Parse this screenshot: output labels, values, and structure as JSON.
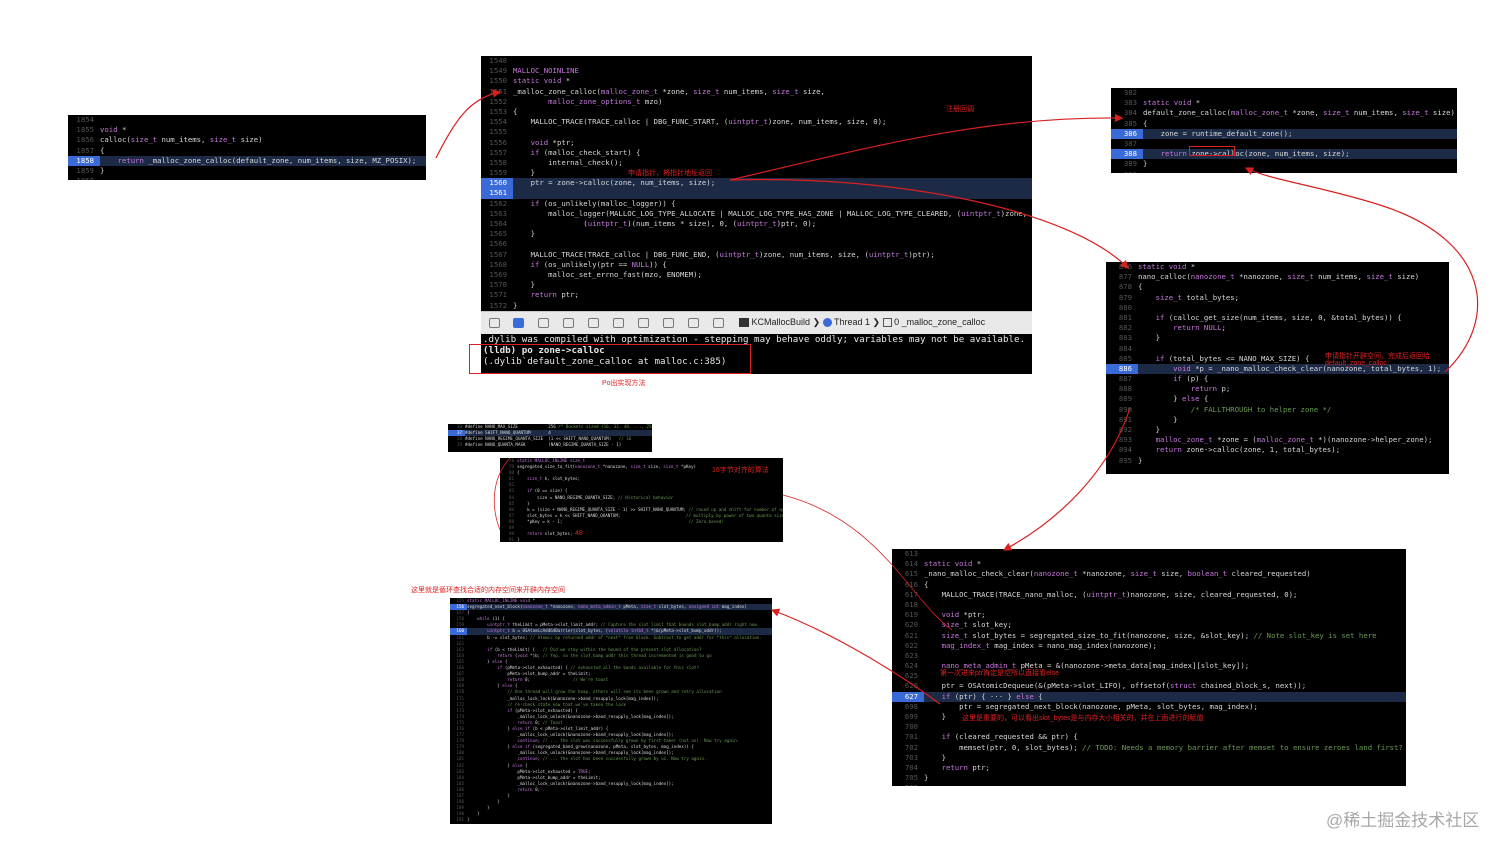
{
  "panels": {
    "calloc": {
      "lines": [
        {
          "n": "1854",
          "t": ""
        },
        {
          "n": "1855",
          "t": "void *"
        },
        {
          "n": "1856",
          "t": "calloc(size_t num_items, size_t size)"
        },
        {
          "n": "1857",
          "t": "{"
        },
        {
          "n": "1858",
          "t": "    return _malloc_zone_calloc(default_zone, num_items, size, MZ_POSIX);",
          "hl": true
        },
        {
          "n": "1859",
          "t": "}"
        },
        {
          "n": "1860",
          "t": ""
        }
      ]
    },
    "malloc_zone_calloc": {
      "lines": [
        {
          "n": "1548",
          "t": ""
        },
        {
          "n": "1549",
          "t": "MALLOC_NOINLINE"
        },
        {
          "n": "1550",
          "t": "static void *"
        },
        {
          "n": "1551",
          "t": "_malloc_zone_calloc(malloc_zone_t *zone, size_t num_items, size_t size,"
        },
        {
          "n": "1552",
          "t": "        malloc_zone_options_t mzo)"
        },
        {
          "n": "1553",
          "t": "{"
        },
        {
          "n": "1554",
          "t": "    MALLOC_TRACE(TRACE_calloc | DBG_FUNC_START, (uintptr_t)zone, num_items, size, 0);"
        },
        {
          "n": "1555",
          "t": ""
        },
        {
          "n": "1556",
          "t": "    void *ptr;"
        },
        {
          "n": "1557",
          "t": "    if (malloc_check_start) {"
        },
        {
          "n": "1558",
          "t": "        internal_check();"
        },
        {
          "n": "1559",
          "t": "    }"
        },
        {
          "n": "1560",
          "t": "    ptr = zone->calloc(zone, num_items, size);",
          "hl": true
        },
        {
          "n": "1561",
          "t": "",
          "hl": true
        },
        {
          "n": "1562",
          "t": "    if (os_unlikely(malloc_logger)) {"
        },
        {
          "n": "1563",
          "t": "        malloc_logger(MALLOC_LOG_TYPE_ALLOCATE | MALLOC_LOG_TYPE_HAS_ZONE | MALLOC_LOG_TYPE_CLEARED, (uintptr_t)zone,"
        },
        {
          "n": "1564",
          "t": "                (uintptr_t)(num_items * size), 0, (uintptr_t)ptr, 0);"
        },
        {
          "n": "1565",
          "t": "    }"
        },
        {
          "n": "1566",
          "t": ""
        },
        {
          "n": "1567",
          "t": "    MALLOC_TRACE(TRACE_calloc | DBG_FUNC_END, (uintptr_t)zone, num_items, size, (uintptr_t)ptr);"
        },
        {
          "n": "1568",
          "t": "    if (os_unlikely(ptr == NULL)) {"
        },
        {
          "n": "1569",
          "t": "        malloc_set_errno_fast(mzo, ENOMEM);"
        },
        {
          "n": "1570",
          "t": "    }"
        },
        {
          "n": "1571",
          "t": "    return ptr;"
        },
        {
          "n": "1572",
          "t": "}"
        }
      ]
    },
    "default_zone_calloc": {
      "lines": [
        {
          "n": "382",
          "t": ""
        },
        {
          "n": "383",
          "t": "static void *"
        },
        {
          "n": "384",
          "t": "default_zone_calloc(malloc_zone_t *zone, size_t num_items, size_t size)"
        },
        {
          "n": "385",
          "t": "{"
        },
        {
          "n": "386",
          "t": "    zone = runtime_default_zone();",
          "hl": true
        },
        {
          "n": "387",
          "t": ""
        },
        {
          "n": "388",
          "t": "    return zone->calloc(zone, num_items, size);",
          "hl": true
        },
        {
          "n": "389",
          "t": "}"
        },
        {
          "n": "390",
          "t": ""
        }
      ]
    },
    "nano_calloc": {
      "lines": [
        {
          "n": "876",
          "t": "static void *"
        },
        {
          "n": "877",
          "t": "nano_calloc(nanozone_t *nanozone, size_t num_items, size_t size)"
        },
        {
          "n": "878",
          "t": "{"
        },
        {
          "n": "879",
          "t": "    size_t total_bytes;"
        },
        {
          "n": "880",
          "t": ""
        },
        {
          "n": "881",
          "t": "    if (calloc_get_size(num_items, size, 0, &total_bytes)) {"
        },
        {
          "n": "882",
          "t": "        return NULL;"
        },
        {
          "n": "883",
          "t": "    }"
        },
        {
          "n": "884",
          "t": ""
        },
        {
          "n": "885",
          "t": "    if (total_bytes <= NANO_MAX_SIZE) {"
        },
        {
          "n": "886",
          "t": "        void *p = _nano_malloc_check_clear(nanozone, total_bytes, 1);",
          "hl": true
        },
        {
          "n": "887",
          "t": "        if (p) {"
        },
        {
          "n": "888",
          "t": "            return p;"
        },
        {
          "n": "889",
          "t": "        } else {"
        },
        {
          "n": "890",
          "t": "            /* FALLTHROUGH to helper zone */"
        },
        {
          "n": "891",
          "t": "        }"
        },
        {
          "n": "892",
          "t": "    }"
        },
        {
          "n": "893",
          "t": "    malloc_zone_t *zone = (malloc_zone_t *)(nanozone->helper_zone);"
        },
        {
          "n": "894",
          "t": "    return zone->calloc(zone, 1, total_bytes);"
        },
        {
          "n": "895",
          "t": "}"
        }
      ]
    },
    "nano_check_clear": {
      "lines": [
        {
          "n": "613",
          "t": ""
        },
        {
          "n": "614",
          "t": "static void *"
        },
        {
          "n": "615",
          "t": "_nano_malloc_check_clear(nanozone_t *nanozone, size_t size, boolean_t cleared_requested)"
        },
        {
          "n": "616",
          "t": "{"
        },
        {
          "n": "617",
          "t": "    MALLOC_TRACE(TRACE_nano_malloc, (uintptr_t)nanozone, size, cleared_requested, 0);"
        },
        {
          "n": "618",
          "t": ""
        },
        {
          "n": "619",
          "t": "    void *ptr;"
        },
        {
          "n": "620",
          "t": "    size_t slot_key;"
        },
        {
          "n": "621",
          "t": "    size_t slot_bytes = segregated_size_to_fit(nanozone, size, &slot_key); // Note slot_key is set here"
        },
        {
          "n": "622",
          "t": "    mag_index_t mag_index = nano_mag_index(nanozone);"
        },
        {
          "n": "623",
          "t": ""
        },
        {
          "n": "624",
          "t": "    nano_meta_admin_t pMeta = &(nanozone->meta_data[mag_index][slot_key]);"
        },
        {
          "n": "625",
          "t": ""
        },
        {
          "n": "626",
          "t": "    ptr = OSAtomicDequeue(&(pMeta->slot_LIFO), offsetof(struct chained_block_s, next));"
        },
        {
          "n": "627",
          "t": "    if (ptr) { ··· } else {",
          "hl": true
        },
        {
          "n": "698",
          "t": "        ptr = segregated_next_block(nanozone, pMeta, slot_bytes, mag_index);"
        },
        {
          "n": "699",
          "t": "    }"
        },
        {
          "n": "700",
          "t": ""
        },
        {
          "n": "701",
          "t": "    if (cleared_requested && ptr) {"
        },
        {
          "n": "702",
          "t": "        memset(ptr, 0, slot_bytes); // TODO: Needs a memory barrier after memset to ensure zeroes land first?"
        },
        {
          "n": "703",
          "t": "    }"
        },
        {
          "n": "704",
          "t": "    return ptr;"
        },
        {
          "n": "705",
          "t": "}"
        },
        {
          "n": "706",
          "t": ""
        }
      ]
    },
    "defines": {
      "lines": [
        {
          "n": "36",
          "t": "#define NANO_MAX_SIZE            256 /* Buckets sized {16, 32, 48, ..., 256} */"
        },
        {
          "n": "37",
          "t": "#define SHIFT_NANO_QUANTUM       4",
          "hl": true
        },
        {
          "n": "38",
          "t": "#define NANO_REGIME_QUANTA_SIZE  (1 << SHIFT_NANO_QUANTUM)   // 16"
        },
        {
          "n": "39",
          "t": "#define NANO_QUANTA_MASK         (NANO_REGIME_QUANTA_SIZE - 1)"
        }
      ]
    },
    "segregated_size": {
      "lines": [
        {
          "n": "78",
          "t": "static MALLOC_INLINE size_t"
        },
        {
          "n": "79",
          "t": "segregated_size_to_fit(nanozone_t *nanozone, size_t size, size_t *pKey)"
        },
        {
          "n": "80",
          "t": "{"
        },
        {
          "n": "81",
          "t": "    size_t k, slot_bytes;"
        },
        {
          "n": "82",
          "t": ""
        },
        {
          "n": "83",
          "t": "    if (0 == size) {"
        },
        {
          "n": "84",
          "t": "        size = NANO_REGIME_QUANTA_SIZE; // Historical behavior"
        },
        {
          "n": "85",
          "t": "    }"
        },
        {
          "n": "86",
          "t": "    k = (size + NANO_REGIME_QUANTA_SIZE - 1) >> SHIFT_NANO_QUANTUM; // round up and shift for number of quanta"
        },
        {
          "n": "87",
          "t": "    slot_bytes = k << SHIFT_NANO_QUANTUM;                          // multiply by power of two quanta size"
        },
        {
          "n": "88",
          "t": "    *pKey = k - 1;                                                  // Zero-based!"
        },
        {
          "n": "89",
          "t": ""
        },
        {
          "n": "90",
          "t": "    return slot_bytes;"
        },
        {
          "n": "91",
          "t": "}"
        }
      ]
    },
    "next_block": {
      "lines": [
        {
          "n": "155",
          "t": "static MALLOC_INLINE void *"
        },
        {
          "n": "156",
          "t": "segregated_next_block(nanozone_t *nanozone, nano_meta_admin_t pMeta, size_t slot_bytes, unsigned int mag_index)",
          "hl": true
        },
        {
          "n": "157",
          "t": "{"
        },
        {
          "n": "158",
          "t": "    while (1) {"
        },
        {
          "n": "159",
          "t": "        uintptr_t theLimit = pMeta->slot_limit_addr; // Capture the slot limit that bounds slot_bump_addr right now"
        },
        {
          "n": "160",
          "t": "        uintptr_t b = OSAtomicAdd64Barrier(slot_bytes, (volatile int64_t *)&(pMeta->slot_bump_addr));",
          "hl": true
        },
        {
          "n": "161",
          "t": "        b -= slot_bytes; // Atomic op returned addr of *next* free block. Subtract to get addr for *this* allocation."
        },
        {
          "n": "162",
          "t": ""
        },
        {
          "n": "163",
          "t": "        if (b < theLimit) {   // Did we stay within the bound of the present slot allocation?"
        },
        {
          "n": "164",
          "t": "            return (void *)b; // Yep, so the slot_bump_addr this thread incremented is good to go"
        },
        {
          "n": "165",
          "t": "        } else {"
        },
        {
          "n": "166",
          "t": "            if (pMeta->slot_exhausted) { // exhausted all the bands available for this slot?"
        },
        {
          "n": "167",
          "t": "                pMeta->slot_bump_addr = theLimit;"
        },
        {
          "n": "168",
          "t": "                return 0;                 // We're toast"
        },
        {
          "n": "169",
          "t": "            } else {"
        },
        {
          "n": "170",
          "t": "                // One thread will grow the heap, others will see its been grown and retry allocation"
        },
        {
          "n": "171",
          "t": "                _malloc_lock_lock(&nanozone->band_resupply_lock[mag_index]);"
        },
        {
          "n": "172",
          "t": "                // re-check state now that we've taken the lock"
        },
        {
          "n": "173",
          "t": "                if (pMeta->slot_exhausted) {"
        },
        {
          "n": "174",
          "t": "                    _malloc_lock_unlock(&nanozone->band_resupply_lock[mag_index]);"
        },
        {
          "n": "175",
          "t": "                    return 0; // Toast"
        },
        {
          "n": "176",
          "t": "                } else if (b < pMeta->slot_limit_addr) {"
        },
        {
          "n": "177",
          "t": "                    _malloc_lock_unlock(&nanozone->band_resupply_lock[mag_index]);"
        },
        {
          "n": "178",
          "t": "                    continue; // ... the slot was successfully grown by first-taker (not us). Now try again."
        },
        {
          "n": "179",
          "t": "                } else if (segregated_band_grow(nanozone, pMeta, slot_bytes, mag_index)) {"
        },
        {
          "n": "180",
          "t": "                    _malloc_lock_unlock(&nanozone->band_resupply_lock[mag_index]);"
        },
        {
          "n": "181",
          "t": "                    continue; // ... the slot has been successfully grown by us. Now try again."
        },
        {
          "n": "182",
          "t": "                } else {"
        },
        {
          "n": "183",
          "t": "                    pMeta->slot_exhausted = TRUE;"
        },
        {
          "n": "184",
          "t": "                    pMeta->slot_bump_addr = theLimit;"
        },
        {
          "n": "185",
          "t": "                    _malloc_lock_unlock(&nanozone->band_resupply_lock[mag_index]);"
        },
        {
          "n": "186",
          "t": "                    return 0;"
        },
        {
          "n": "187",
          "t": "                }"
        },
        {
          "n": "188",
          "t": "            }"
        },
        {
          "n": "189",
          "t": "        }"
        },
        {
          "n": "190",
          "t": "    }"
        },
        {
          "n": "191",
          "t": "}"
        }
      ]
    }
  },
  "toolbar": {
    "target": "KCMallocBuild",
    "thread": "Thread 1",
    "frame": "0 _malloc_zone_calloc"
  },
  "console": {
    "line1": ".dylib was compiled with optimization - stepping may behave oddly; variables may not be available.",
    "line2": "(lldb) po zone->calloc",
    "line3": "(.dylib`default_zone_calloc at malloc.c:385)"
  },
  "annotations": {
    "register_callback": "注册回调",
    "request_pointer": "申请指针，将指针地址返回",
    "po_method": "Po出实现方法",
    "request_space": "申请指针开辟空间，完成后返回给",
    "request_space2": "default_zone_calloc",
    "align16": "16字节对齐的算法",
    "num48": "48",
    "loop_find": "这里就是循环查找合适的内存空间来开辟内存空间",
    "first_ptr": "第一次进来ptr肯定是空所以直接看else",
    "key_point": "这里是重要的，可以看出slot_bytes是与内存大小相关的，并在上面进行的赋值"
  },
  "watermark": "@稀土掘金技术社区",
  "colors": {
    "keyword": "#c678dd",
    "type": "#56b6c2",
    "func": "#e6e6e6",
    "accent": "#3a6ad8",
    "annotation": "#e02020"
  }
}
